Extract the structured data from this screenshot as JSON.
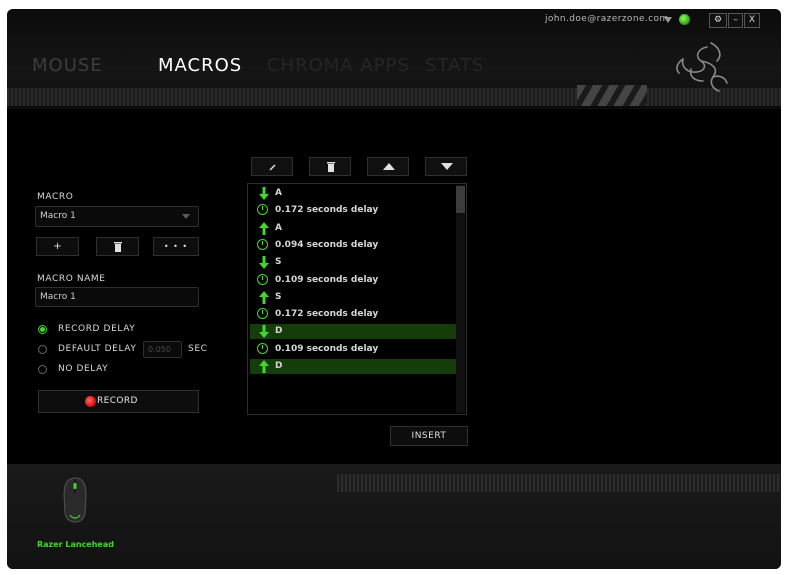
{
  "header": {
    "account_email": "john.doe@razerzone.com",
    "settings_label": "⚙",
    "minimize_label": "–",
    "close_label": "X"
  },
  "tabs": [
    {
      "label": "MOUSE"
    },
    {
      "label": "MACROS"
    },
    {
      "label": "CHROMA APPS"
    },
    {
      "label": "STATS"
    }
  ],
  "macro_panel": {
    "macro_label": "MACRO",
    "macro_select_value": "Macro 1",
    "add_label": "+",
    "more_label": "• • •",
    "name_label": "MACRO NAME",
    "name_value": "Macro 1",
    "record_delay_label": "RECORD DELAY",
    "default_delay_label": "DEFAULT DELAY",
    "default_delay_value": "0.050",
    "default_delay_unit": "SEC",
    "no_delay_label": "NO DELAY",
    "record_label": "RECORD"
  },
  "macro_list": [
    {
      "type": "down",
      "text": "A",
      "selected": false
    },
    {
      "type": "delay",
      "text": "0.172 seconds delay",
      "selected": false
    },
    {
      "type": "up",
      "text": "A",
      "selected": false
    },
    {
      "type": "delay",
      "text": "0.094 seconds delay",
      "selected": false
    },
    {
      "type": "down",
      "text": "S",
      "selected": false
    },
    {
      "type": "delay",
      "text": "0.109 seconds delay",
      "selected": false
    },
    {
      "type": "up",
      "text": "S",
      "selected": false
    },
    {
      "type": "delay",
      "text": "0.172 seconds delay",
      "selected": false
    },
    {
      "type": "down",
      "text": "D",
      "selected": true
    },
    {
      "type": "delay",
      "text": "0.109 seconds delay",
      "selected": false
    },
    {
      "type": "up",
      "text": "D",
      "selected": true
    }
  ],
  "insert_label": "INSERT",
  "device": {
    "name": "Razer Lancehead"
  },
  "colors": {
    "accent": "#44d62c",
    "record": "#e31818",
    "selected_row": "#153d0a"
  }
}
